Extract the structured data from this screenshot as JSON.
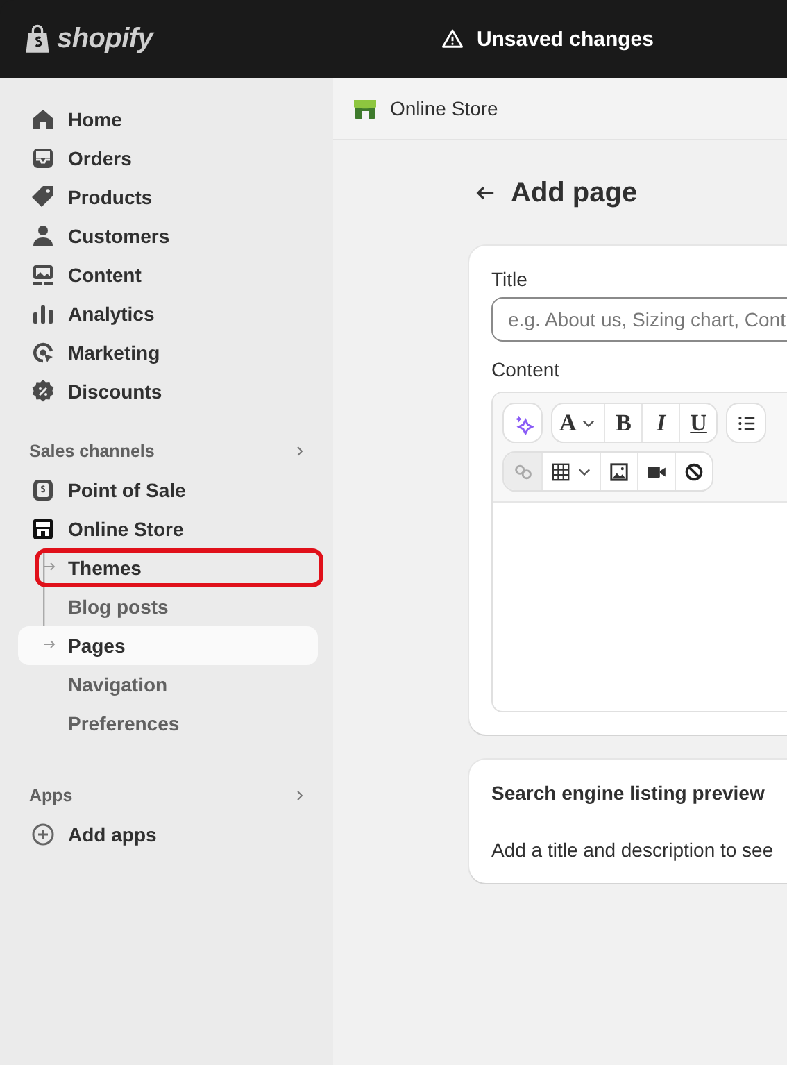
{
  "topbar": {
    "brand": "shopify",
    "status": "Unsaved changes"
  },
  "sidebar": {
    "nav": [
      {
        "label": "Home"
      },
      {
        "label": "Orders"
      },
      {
        "label": "Products"
      },
      {
        "label": "Customers"
      },
      {
        "label": "Content"
      },
      {
        "label": "Analytics"
      },
      {
        "label": "Marketing"
      },
      {
        "label": "Discounts"
      }
    ],
    "sections": [
      {
        "title": "Sales channels",
        "items": [
          {
            "label": "Point of Sale"
          },
          {
            "label": "Online Store",
            "children": [
              {
                "label": "Themes",
                "selected": false,
                "annotated": true
              },
              {
                "label": "Blog posts",
                "selected": false,
                "annotated": false
              },
              {
                "label": "Pages",
                "selected": true,
                "annotated": false
              },
              {
                "label": "Navigation",
                "selected": false,
                "annotated": false
              },
              {
                "label": "Preferences",
                "selected": false,
                "annotated": false
              }
            ]
          }
        ]
      },
      {
        "title": "Apps",
        "items": [
          {
            "label": "Add apps"
          }
        ]
      }
    ]
  },
  "header": {
    "title": "Online Store"
  },
  "page": {
    "title": "Add page"
  },
  "form": {
    "title_label": "Title",
    "title_placeholder": "e.g. About us, Sizing chart, Cont",
    "content_label": "Content",
    "toolbar": [
      [
        [
          {
            "kind": "ai",
            "dropdown": false,
            "disabled": false
          }
        ],
        [
          {
            "kind": "font",
            "label": "A",
            "dropdown": true,
            "disabled": false
          },
          {
            "kind": "bold",
            "label": "B",
            "dropdown": false,
            "disabled": false
          },
          {
            "kind": "italic",
            "label": "I",
            "dropdown": false,
            "disabled": false
          },
          {
            "kind": "underline",
            "label": "U",
            "dropdown": false,
            "disabled": false
          }
        ],
        [
          {
            "kind": "list",
            "dropdown": false,
            "disabled": false
          }
        ]
      ],
      [
        [
          {
            "kind": "link",
            "dropdown": false,
            "disabled": true
          },
          {
            "kind": "table",
            "dropdown": true,
            "disabled": false
          },
          {
            "kind": "image",
            "dropdown": false,
            "disabled": false
          },
          {
            "kind": "video",
            "dropdown": false,
            "disabled": false
          },
          {
            "kind": "clear",
            "dropdown": false,
            "disabled": false
          }
        ]
      ]
    ]
  },
  "seo": {
    "title": "Search engine listing preview",
    "text": "Add a title and description to see"
  }
}
